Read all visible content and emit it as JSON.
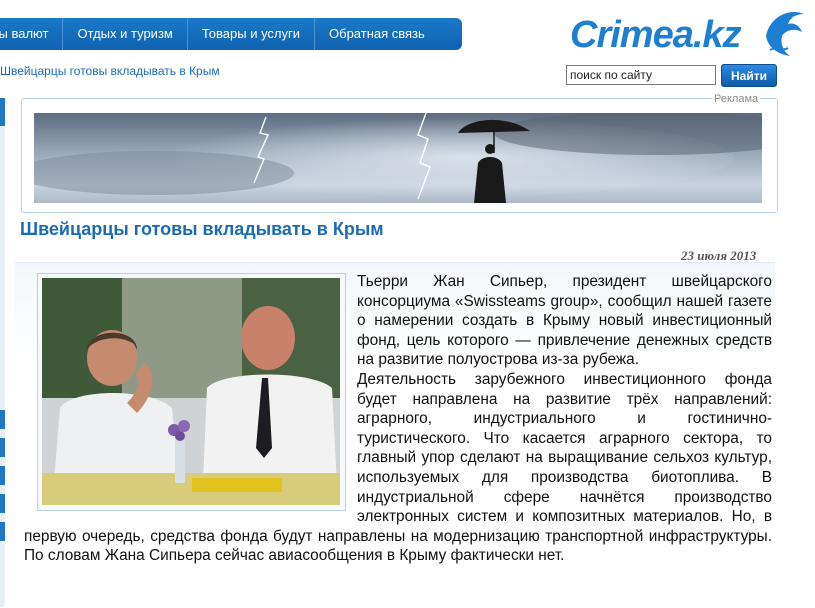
{
  "nav": {
    "items": [
      "сы валют",
      "Отдых и туризм",
      "Товары и услуги",
      "Обратная связь"
    ]
  },
  "logo": {
    "text": "Crimea.kz"
  },
  "breadcrumb": "Швейцарцы готовы вкладывать в Крым",
  "search": {
    "value": "поиск по сайту",
    "button_label": "Найти"
  },
  "ad": {
    "label": "Реклама"
  },
  "article": {
    "title": "Швейцарцы готовы вкладывать в Крым",
    "date": "23 июля 2013",
    "paragraph1": "Тьерри Жан Сипьер, президент швейцарского консорциума «Swissteams group», сообщил нашей газете о намерении создать в Крыму новый инвестиционный фонд, цель которого — привлечение денежных средств на развитие полуострова из-за рубежа.",
    "paragraph2": "Деятельность зарубежного инвестиционного фонда будет направлена на развитие трёх направлений: аграрного, индустриального и гостинично-туристического. Что касается аграрного сектора, то главный упор сделают на выращивание сельхоз культур, используемых для производства биотоплива. В индустриальной сфере начнётся производство электронных систем и композитных материалов. Но, в первую очередь, средства фонда будут направлены на модернизацию транспортной инфраструктуры. По словам Жана Сипьера сейчас авиасообщения в Крыму фактически нет."
  },
  "colors": {
    "brand": "#1b6ab5",
    "nav_bg": "#1670c0"
  }
}
